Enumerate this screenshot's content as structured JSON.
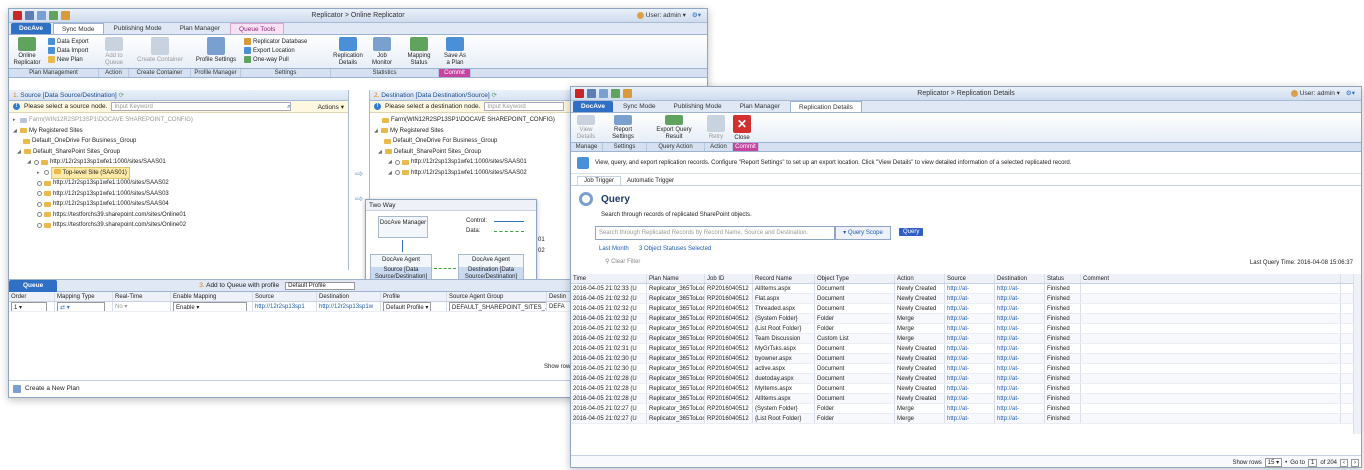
{
  "back_window": {
    "title": "Replicator > Online Replicator",
    "user": "User: admin",
    "tabs": [
      "DocAve",
      "Sync Mode",
      "Publishing Mode",
      "Plan Manager",
      "Queue Tools"
    ],
    "ribbon": {
      "online_replicator": "Online Replicator",
      "data_export": "Data Export",
      "data_import": "Data Import",
      "new_plan": "New Plan",
      "add_to_queue": "Add to Queue",
      "create_container": "Create Container",
      "profile_settings": "Profile Settings",
      "replicator_database": "Replicator Database",
      "export_location": "Export Location",
      "one_way_pull": "One-way Pull",
      "replication_details": "Replication Details",
      "job_monitor": "Job Monitor",
      "mapping_status": "Mapping Status",
      "save_as_plan": "Save As a Plan"
    },
    "groups": [
      "Plan Management",
      "Action",
      "Create Container",
      "Profile Manager",
      "Settings",
      "Statistics",
      "Commit"
    ],
    "source": {
      "header_num": "1.",
      "header": "Source [Data Source/Destination]",
      "prompt": "Please select a source node.",
      "placeholder": "Input Keyword",
      "actions": "Actions",
      "tree": [
        "Farm(WIN12R2SP13SP1\\DOCAVE SHAREPOINT_CONFIG)",
        "My Registered Sites",
        "Default_OneDrive For Business_Group",
        "Default_SharePoint Sites_Group",
        "http://12r2sp13sp1wfe1:1000/sites/SAAS01",
        "Top-level Site (SAAS01)",
        "http://12r2sp13sp1wfe1:1000/sites/SAAS02",
        "http://12r2sp13sp1wfe1:1000/sites/SAAS03",
        "http://12r2sp13sp1wfe1:1000/sites/SAAS04",
        "https://testforchs39.sharepoint.com/sites/Online01",
        "https://testforchs39.sharepoint.com/sites/Online02"
      ]
    },
    "destination": {
      "header_num": "2.",
      "header": "Destination [Data Destination/Source]",
      "prompt": "Please select a destination node.",
      "placeholder": "Input Keyword",
      "tree": [
        "Farm(WIN12R2SP13SP1\\DOCAVE SHAREPOINT_CONFIG)",
        "My Registered Sites",
        "Default_OneDrive For Business_Group",
        "Default_SharePoint Sites_Group",
        "http://12r2sp13sp1wfe1:1000/sites/SAAS01",
        "http://12r2sp13sp1wfe1:1000/sites/SAAS02"
      ],
      "partial_1": "01",
      "partial_2": "02"
    },
    "two_way": {
      "title": "Two Way",
      "docave_manager": "DocAve Manager",
      "control": "Control:",
      "data": "Data:",
      "agent1": "DocAve Agent",
      "agent1_sub": "Source [Data Source/Destination]",
      "agent2": "DocAve Agent",
      "agent2_sub": "Destination [Data Source/Destination]"
    },
    "queue": {
      "tab": "Queue",
      "step_num": "3.",
      "step": "Add to Queue with profile",
      "profile": "Default Profile",
      "columns": [
        "Order",
        "Mapping Type",
        "Real-Time",
        "Enable Mapping",
        "Source",
        "Destination",
        "Profile",
        "Source Agent Group",
        "Destin"
      ],
      "row": [
        "1",
        "",
        "No",
        "Enable",
        "http://12r2sp13sp1",
        "http://12r2sp13sp1w",
        "Default Profile",
        "DEFAULT_SHAREPOINT_SITES_...",
        "DEFA"
      ],
      "show_rows": "Show row"
    },
    "create_new_plan": "Create a New Plan"
  },
  "front_window": {
    "title": "Replicator > Replication Details",
    "user": "User: admin",
    "tabs": [
      "DocAve",
      "Sync Mode",
      "Publishing Mode",
      "Plan Manager",
      "Replication Details"
    ],
    "ribbon": {
      "view_details": "View Details",
      "report_settings": "Report Settings",
      "export_query_result": "Export Query Result",
      "retry": "Retry",
      "close": "Close"
    },
    "groups": [
      "Manage",
      "Settings",
      "Query Action",
      "Action",
      "Commit"
    ],
    "description": "View, query, and export replication records. Configure \"Report Settings\" to set up an export location. Click \"View Details\" to view detailed information of a selected replicated record.",
    "subtabs": [
      "Job Trigger",
      "Automatic Trigger"
    ],
    "query_title": "Query",
    "query_desc": "Search through records of replicated SharePoint objects.",
    "search_placeholder": "Search through Replicated Records by Record Name, Source and Destination.",
    "query_scope": "Query Scope",
    "query_button": "Query",
    "last_month": "Last Month",
    "statuses_selected": "3 Object Statuses Selected",
    "clear_filter": "Clear Filter",
    "last_query_time": "Last Query Time: 2016-04-08 15:06:37",
    "columns": [
      "Time",
      "Plan Name",
      "Job ID",
      "Record Name",
      "Object Type",
      "Action",
      "Source",
      "Destination",
      "Status",
      "Comment"
    ],
    "rows": [
      [
        "2016-04-05 21:02:33 (U",
        "Replicator_365ToLoc",
        "RP2016040512",
        "AllItems.aspx",
        "Document",
        "Newly Created",
        "http://at-",
        "http://at-",
        "Finished",
        ""
      ],
      [
        "2016-04-05 21:02:32 (U",
        "Replicator_365ToLoc",
        "RP2016040512",
        "Flat.aspx",
        "Document",
        "Newly Created",
        "http://at-",
        "http://at-",
        "Finished",
        ""
      ],
      [
        "2016-04-05 21:02:32 (U",
        "Replicator_365ToLoc",
        "RP2016040512",
        "Threaded.aspx",
        "Document",
        "Newly Created",
        "http://at-",
        "http://at-",
        "Finished",
        ""
      ],
      [
        "2016-04-05 21:02:32 (U",
        "Replicator_365ToLoc",
        "RP2016040512",
        "{System Folder}",
        "Folder",
        "Merge",
        "http://at-",
        "http://at-",
        "Finished",
        ""
      ],
      [
        "2016-04-05 21:02:32 (U",
        "Replicator_365ToLoc",
        "RP2016040512",
        "{List Root Folder}",
        "Folder",
        "Merge",
        "http://at-",
        "http://at-",
        "Finished",
        ""
      ],
      [
        "2016-04-05 21:02:32 (U",
        "Replicator_365ToLoc",
        "RP2016040512",
        "Team Discussion",
        "Custom List",
        "Merge",
        "http://at-",
        "http://at-",
        "Finished",
        ""
      ],
      [
        "2016-04-05 21:02:31 (U",
        "Replicator_365ToLoc",
        "RP2016040512",
        "MyGrTsks.aspx",
        "Document",
        "Newly Created",
        "http://at-",
        "http://at-",
        "Finished",
        ""
      ],
      [
        "2016-04-05 21:02:30 (U",
        "Replicator_365ToLoc",
        "RP2016040512",
        "byowner.aspx",
        "Document",
        "Newly Created",
        "http://at-",
        "http://at-",
        "Finished",
        ""
      ],
      [
        "2016-04-05 21:02:30 (U",
        "Replicator_365ToLoc",
        "RP2016040512",
        "active.aspx",
        "Document",
        "Newly Created",
        "http://at-",
        "http://at-",
        "Finished",
        ""
      ],
      [
        "2016-04-05 21:02:28 (U",
        "Replicator_365ToLoc",
        "RP2016040512",
        "duetoday.aspx",
        "Document",
        "Newly Created",
        "http://at-",
        "http://at-",
        "Finished",
        ""
      ],
      [
        "2016-04-05 21:02:28 (U",
        "Replicator_365ToLoc",
        "RP2016040512",
        "MyItems.aspx",
        "Document",
        "Newly Created",
        "http://at-",
        "http://at-",
        "Finished",
        ""
      ],
      [
        "2016-04-05 21:02:28 (U",
        "Replicator_365ToLoc",
        "RP2016040512",
        "AllItems.aspx",
        "Document",
        "Newly Created",
        "http://at-",
        "http://at-",
        "Finished",
        ""
      ],
      [
        "2016-04-05 21:02:27 (U",
        "Replicator_365ToLoc",
        "RP2016040512",
        "{System Folder}",
        "Folder",
        "Merge",
        "http://at-",
        "http://at-",
        "Finished",
        ""
      ],
      [
        "2016-04-05 21:02:27 (U",
        "Replicator_365ToLoc",
        "RP2016040512",
        "{List Root Folder}",
        "Folder",
        "Merge",
        "http://at-",
        "http://at-",
        "Finished",
        ""
      ]
    ],
    "pager": {
      "show_rows": "Show rows",
      "rows_value": "15",
      "goto": "Go to",
      "page": "1",
      "of_total": "of 204"
    }
  }
}
